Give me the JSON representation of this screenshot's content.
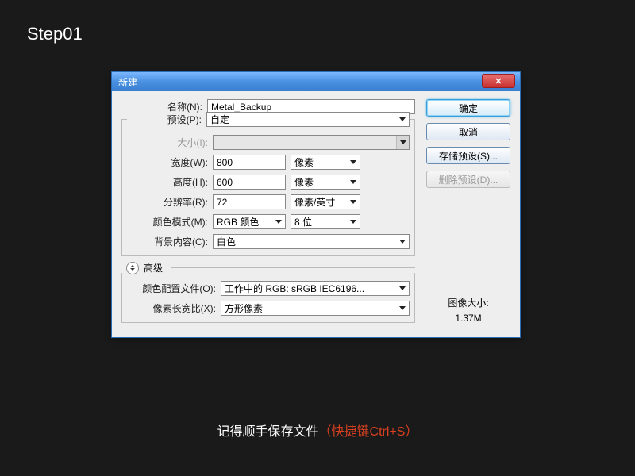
{
  "step_label": "Step01",
  "dialog": {
    "title": "新建",
    "labels": {
      "name": "名称(N):",
      "preset": "预设(P):",
      "size": "大小(I):",
      "width": "宽度(W):",
      "height": "高度(H):",
      "resolution": "分辨率(R):",
      "color_mode": "颜色模式(M):",
      "bg": "背景内容(C):",
      "advanced": "高级",
      "profile": "颜色配置文件(O):",
      "aspect": "像素长宽比(X):"
    },
    "values": {
      "name": "Metal_Backup",
      "preset": "自定",
      "size": "",
      "width": "800",
      "height": "600",
      "resolution": "72",
      "color_mode": "RGB 颜色",
      "bit_depth": "8 位",
      "bg": "白色",
      "profile": "工作中的 RGB: sRGB IEC6196...",
      "aspect": "方形像素"
    },
    "units": {
      "width": "像素",
      "height": "像素",
      "resolution": "像素/英寸"
    },
    "buttons": {
      "ok": "确定",
      "cancel": "取消",
      "save_preset": "存储预设(S)...",
      "delete_preset": "删除预设(D)..."
    },
    "image_size_label": "图像大小:",
    "image_size_value": "1.37M"
  },
  "footnote": {
    "text": "记得顺手保存文件",
    "hint": "（快捷键Ctrl+S）"
  }
}
